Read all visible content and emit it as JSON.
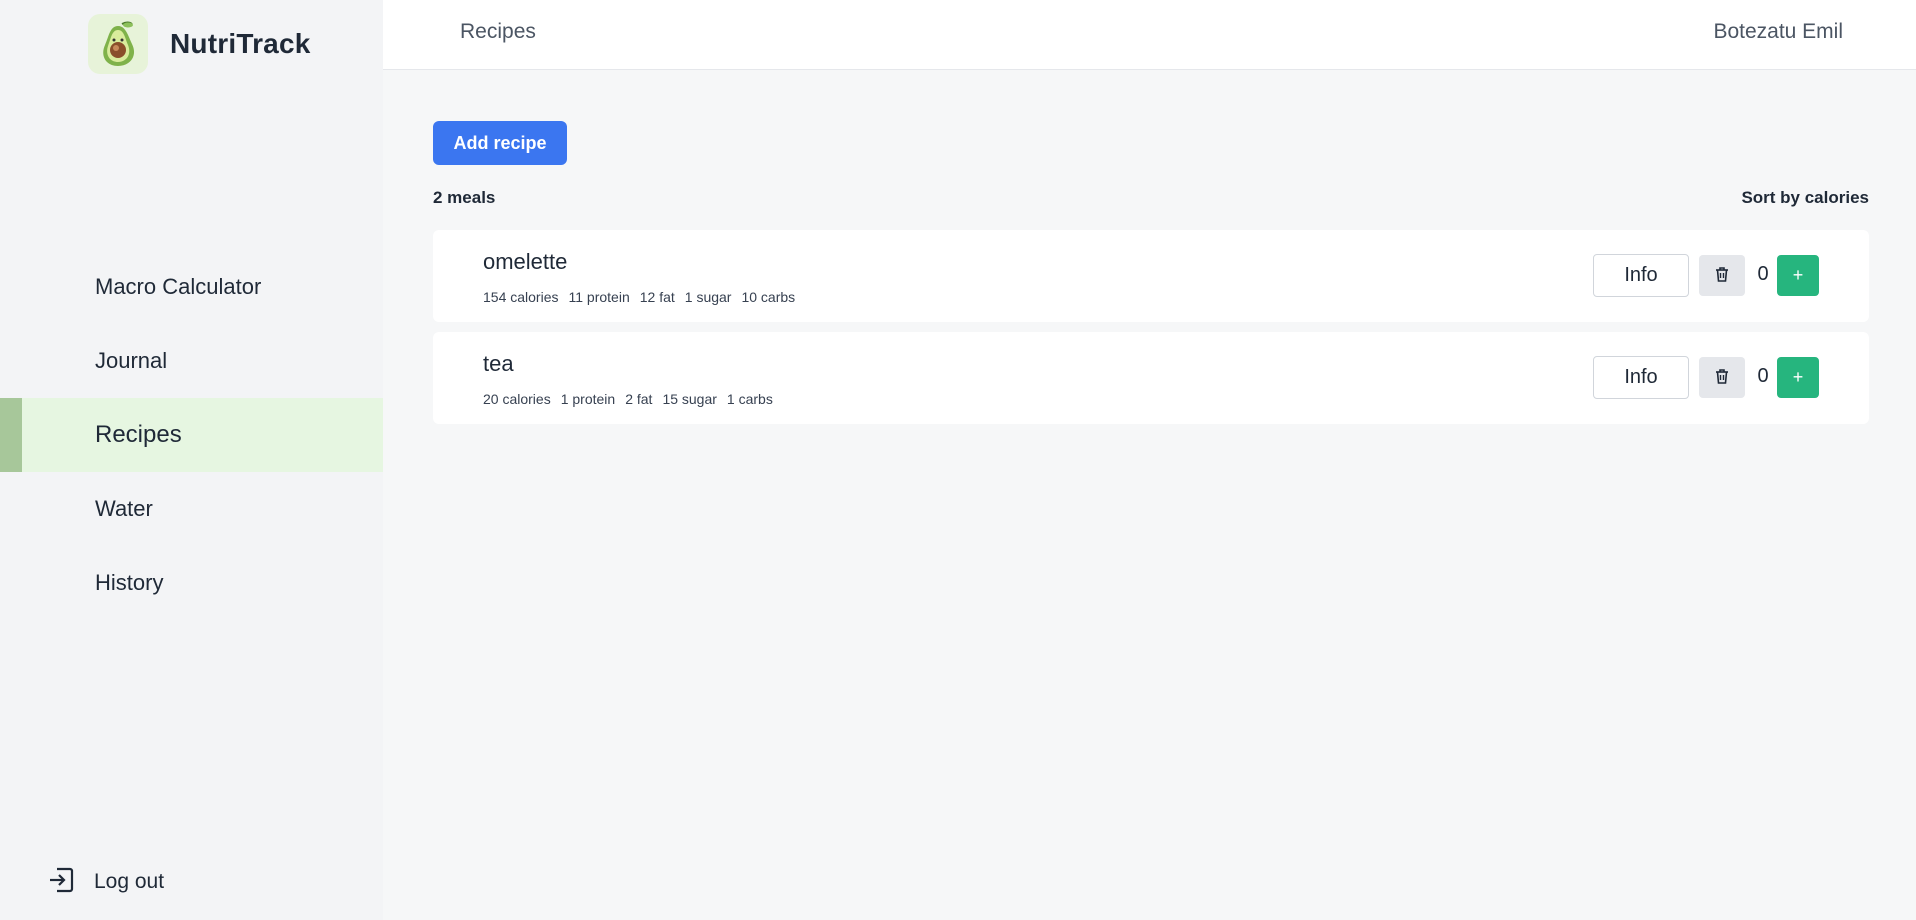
{
  "app": {
    "name": "NutriTrack",
    "logo_icon": "avocado-icon"
  },
  "sidebar": {
    "items": [
      {
        "label": "Macro Calculator",
        "active": false
      },
      {
        "label": "Journal",
        "active": false
      },
      {
        "label": "Recipes",
        "active": true
      },
      {
        "label": "Water",
        "active": false
      },
      {
        "label": "History",
        "active": false
      }
    ],
    "logout_label": "Log out"
  },
  "header": {
    "title": "Recipes",
    "user": "Botezatu Emil"
  },
  "main": {
    "add_button": "Add recipe",
    "meal_count": "2 meals",
    "sort_label": "Sort by calories",
    "meals": [
      {
        "name": "omelette",
        "stats": [
          "154 calories",
          "11 protein",
          "12 fat",
          "1 sugar",
          "10 carbs"
        ],
        "info_label": "Info",
        "quantity": "0",
        "add_label": "+"
      },
      {
        "name": "tea",
        "stats": [
          "20 calories",
          "1 protein",
          "2 fat",
          "15 sugar",
          "1 carbs"
        ],
        "info_label": "Info",
        "quantity": "0",
        "add_label": "+"
      }
    ]
  },
  "colors": {
    "primary": "#3b76f0",
    "success": "#26b57e",
    "active_nav_bg": "#e6f6e1",
    "active_nav_bar": "#a7c79a"
  }
}
